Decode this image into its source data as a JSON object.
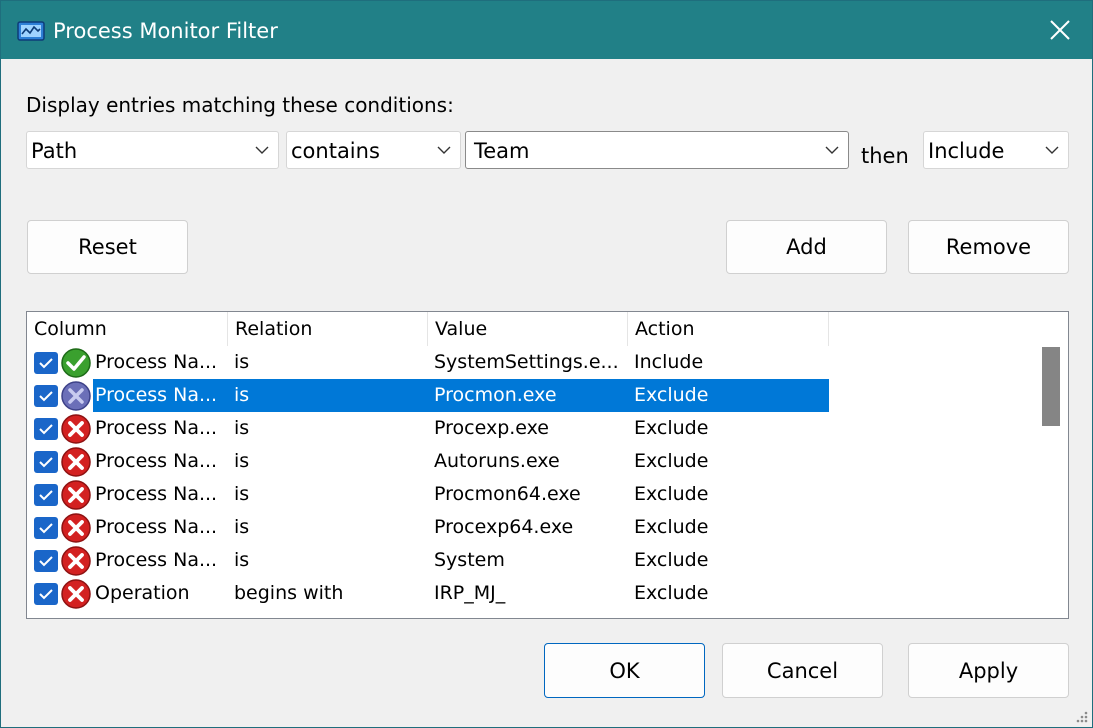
{
  "window": {
    "title": "Process Monitor Filter",
    "colors": {
      "titlebar": "#218087",
      "selection": "#0078d7",
      "checkbox": "#1a66c9"
    }
  },
  "filter": {
    "prompt": "Display entries matching these conditions:",
    "column_value": "Path",
    "relation_value": "contains",
    "value_text": "Team",
    "then_label": "then",
    "action_value": "Include"
  },
  "buttons": {
    "reset": "Reset",
    "add": "Add",
    "remove": "Remove",
    "ok": "OK",
    "cancel": "Cancel",
    "apply": "Apply"
  },
  "table": {
    "headers": [
      "Column",
      "Relation",
      "Value",
      "Action"
    ],
    "rows": [
      {
        "checked": true,
        "status": "include-check-icon",
        "column": "Process Na...",
        "relation": "is",
        "value": "SystemSettings.e...",
        "action": "Include"
      },
      {
        "checked": true,
        "status": "exclude-disabled-icon",
        "column": "Process Na...",
        "relation": "is",
        "value": "Procmon.exe",
        "action": "Exclude",
        "selected": true
      },
      {
        "checked": true,
        "status": "exclude-x-icon",
        "column": "Process Na...",
        "relation": "is",
        "value": "Procexp.exe",
        "action": "Exclude"
      },
      {
        "checked": true,
        "status": "exclude-x-icon",
        "column": "Process Na...",
        "relation": "is",
        "value": "Autoruns.exe",
        "action": "Exclude"
      },
      {
        "checked": true,
        "status": "exclude-x-icon",
        "column": "Process Na...",
        "relation": "is",
        "value": "Procmon64.exe",
        "action": "Exclude"
      },
      {
        "checked": true,
        "status": "exclude-x-icon",
        "column": "Process Na...",
        "relation": "is",
        "value": "Procexp64.exe",
        "action": "Exclude"
      },
      {
        "checked": true,
        "status": "exclude-x-icon",
        "column": "Process Na...",
        "relation": "is",
        "value": "System",
        "action": "Exclude"
      },
      {
        "checked": true,
        "status": "exclude-x-icon",
        "column": "Operation",
        "relation": "begins with",
        "value": "IRP_MJ_",
        "action": "Exclude"
      }
    ]
  }
}
